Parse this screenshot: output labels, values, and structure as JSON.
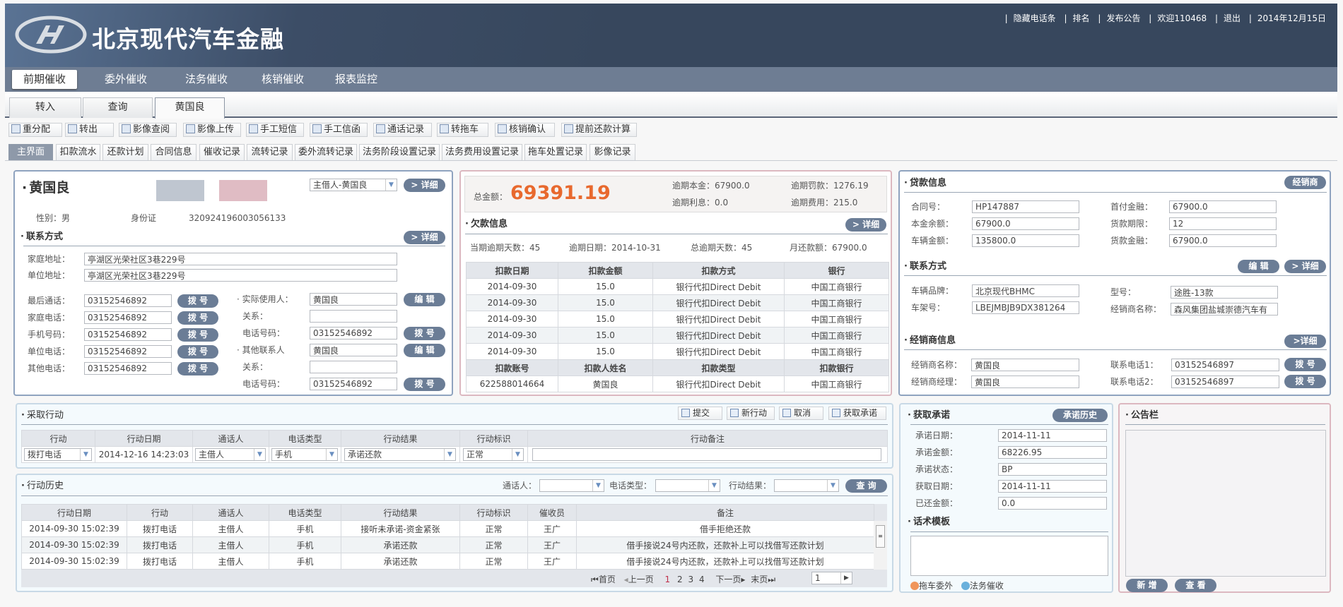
{
  "header": {
    "brand": "北京现代汽车金融",
    "links": [
      "隐藏电话条",
      "排名",
      "发布公告",
      "欢迎110468",
      "退出",
      "2014年12月15日"
    ]
  },
  "nav": [
    "前期催收",
    "委外催收",
    "法务催收",
    "核销催收",
    "报表监控"
  ],
  "tabs": [
    "转入",
    "查询",
    "黄国良"
  ],
  "toolbar": [
    "重分配",
    "转出",
    "影像查阅",
    "影像上传",
    "手工短信",
    "手工信函",
    "通话记录",
    "转拖车",
    "核销确认",
    "提前还款计算"
  ],
  "subtabs": [
    "主界面",
    "扣款流水",
    "还款计划",
    "合同信息",
    "催收记录",
    "流转记录",
    "委外流转记录",
    "法务阶段设置记录",
    "法务费用设置记录",
    "拖车处置记录",
    "影像记录"
  ],
  "borrower": {
    "name": "黄国良",
    "role_select": "主借人-黄国良",
    "detail": "> 详细",
    "gender": "性别：男",
    "id_label": "身份证",
    "id_number": "320924196003056133",
    "contact_title": "联系方式",
    "home_addr_label": "家庭地址：",
    "home_addr": "亭湖区光荣社区3巷229号",
    "work_addr_label": "单位地址：",
    "work_addr": "亭湖区光荣社区3巷229号",
    "phones": [
      {
        "label": "最后通话：",
        "value": "03152546892"
      },
      {
        "label": "家庭电话：",
        "value": "03152546892"
      },
      {
        "label": "手机号码：",
        "value": "03152546892"
      },
      {
        "label": "单位电话：",
        "value": "03152546892"
      },
      {
        "label": "其他电话：",
        "value": "03152546892"
      }
    ],
    "dial": "拨 号",
    "edit": "编 辑",
    "actual_user_label": "实际使用人：",
    "actual_user": "黄国良",
    "relation_label": "关系：",
    "phone_label": "电话号码：",
    "actual_user_phone": "03152546892",
    "other_contact_label": "其他联系人",
    "other_contact": "黄国良",
    "other_contact_phone": "03152546892"
  },
  "arrears": {
    "total_label": "总金额：",
    "total": "69391.19",
    "overdue_principal": "逾期本金：67900.0",
    "overdue_interest": "逾期利息：0.0",
    "overdue_penalty": "逾期罚款：1276.19",
    "overdue_fee": "逾期费用：215.0",
    "title": "欠款信息",
    "detail": "> 详细",
    "stats": [
      "当期逾期天数：45",
      "逾期日期：2014-10-31",
      "总逾期天数：45",
      "月还款额：67900.0"
    ],
    "table_headers": [
      "扣款日期",
      "扣款金额",
      "扣款方式",
      "银行"
    ],
    "rows": [
      [
        "2014-09-30",
        "15.0",
        "银行代扣Direct Debit",
        "中国工商银行"
      ],
      [
        "2014-09-30",
        "15.0",
        "银行代扣Direct Debit",
        "中国工商银行"
      ],
      [
        "2014-09-30",
        "15.0",
        "银行代扣Direct Debit",
        "中国工商银行"
      ],
      [
        "2014-09-30",
        "15.0",
        "银行代扣Direct Debit",
        "中国工商银行"
      ],
      [
        "2014-09-30",
        "15.0",
        "银行代扣Direct Debit",
        "中国工商银行"
      ]
    ],
    "account_headers": [
      "扣款账号",
      "扣款人姓名",
      "扣款类型",
      "扣款银行"
    ],
    "account_row": [
      "622588014664",
      "黄国良",
      "银行代扣Direct Debit",
      "中国工商银行"
    ]
  },
  "loan": {
    "title": "贷款信息",
    "dealer_btn": "经销商",
    "fields_left": [
      {
        "label": "合同号：",
        "value": "HP147887"
      },
      {
        "label": "本金余额：",
        "value": "67900.0"
      },
      {
        "label": "车辆金额：",
        "value": "135800.0"
      }
    ],
    "fields_right": [
      {
        "label": "首付金融：",
        "value": "67900.0"
      },
      {
        "label": "货款期限：",
        "value": "12"
      },
      {
        "label": "货款金融：",
        "value": "67900.0"
      }
    ],
    "contact_title": "联系方式",
    "edit": "编 辑",
    "detail": "> 详细",
    "brand_label": "车辆品牌：",
    "brand": "北京现代BHMC",
    "vin_label": "车架号：",
    "vin": "LBEJMBJB9DX381264",
    "model_label": "型号：",
    "model": "途胜-13款",
    "dealer_name_label": "经销商名称：",
    "dealer_name": "森风集团盐城崇德汽车有",
    "dealer_title": "经销商信息",
    "dealer_detail": ">详细",
    "dealer_contact_label": "经销商名称：",
    "dealer_contact": "黄国良",
    "dealer_manager_label": "经销商经理：",
    "dealer_manager": "黄国良",
    "phone1_label": "联系电话1：",
    "phone1": "03152546897",
    "phone2_label": "联系电话2：",
    "phone2": "03152546897",
    "dial": "拨 号"
  },
  "action": {
    "title": "采取行动",
    "buttons": [
      "提交",
      "新行动",
      "取消",
      "获取承诺"
    ],
    "headers": [
      "行动",
      "行动日期",
      "通话人",
      "电话类型",
      "行动结果",
      "行动标识",
      "行动备注"
    ],
    "values": [
      "拨打电话",
      "2014-12-16 14:23:03",
      "主借人",
      "手机",
      "承诺还款",
      "正常",
      ""
    ]
  },
  "history": {
    "title": "行动历史",
    "filter_caller": "通话人：",
    "filter_phone_type": "电话类型：",
    "filter_result": "行动结果：",
    "query": "查 询",
    "headers": [
      "行动日期",
      "行动",
      "通话人",
      "电话类型",
      "行动结果",
      "行动标识",
      "催收员",
      "备注"
    ],
    "rows": [
      [
        "2014-09-30   15:02:39",
        "拨打电话",
        "主借人",
        "手机",
        "接听未承诺-资金紧张",
        "正常",
        "王广",
        "借手拒绝还款"
      ],
      [
        "2014-09-30   15:02:39",
        "拨打电话",
        "主借人",
        "手机",
        "承诺还款",
        "正常",
        "王广",
        "借手接说24号内还款，还款补上可以找借写还款计划"
      ],
      [
        "2014-09-30   15:02:39",
        "拨打电话",
        "主借人",
        "手机",
        "承诺还款",
        "正常",
        "王广",
        "借手接说24号内还款，还款补上可以找借写还款计划"
      ]
    ],
    "pager": {
      "first": "首页",
      "prev": "上一页",
      "pages": [
        "1",
        "2",
        "3",
        "4"
      ],
      "current": "1",
      "next": "下一页",
      "last": "末页",
      "page_input": "1"
    }
  },
  "promise": {
    "title": "获取承诺",
    "history_btn": "承诺历史",
    "fields": [
      {
        "label": "承诺日期：",
        "value": "2014-11-11"
      },
      {
        "label": "承诺金额：",
        "value": "68226.95"
      },
      {
        "label": "承诺状态：",
        "value": "BP"
      },
      {
        "label": "获取日期：",
        "value": "2014-11-11"
      },
      {
        "label": "已还金额：",
        "value": "0.0"
      }
    ],
    "script_title": "话术模板",
    "legend": [
      {
        "label": "拖车委外",
        "color": "#f0965a"
      },
      {
        "label": "法务催收",
        "color": "#6ab0dc"
      }
    ]
  },
  "board": {
    "title": "公告栏",
    "add": "新 增",
    "view": "查 看"
  },
  "colors": {
    "accent_orange": "#e8692e",
    "button": "#6b7d96",
    "header": "#37475d",
    "nav": "#6e7d93"
  }
}
